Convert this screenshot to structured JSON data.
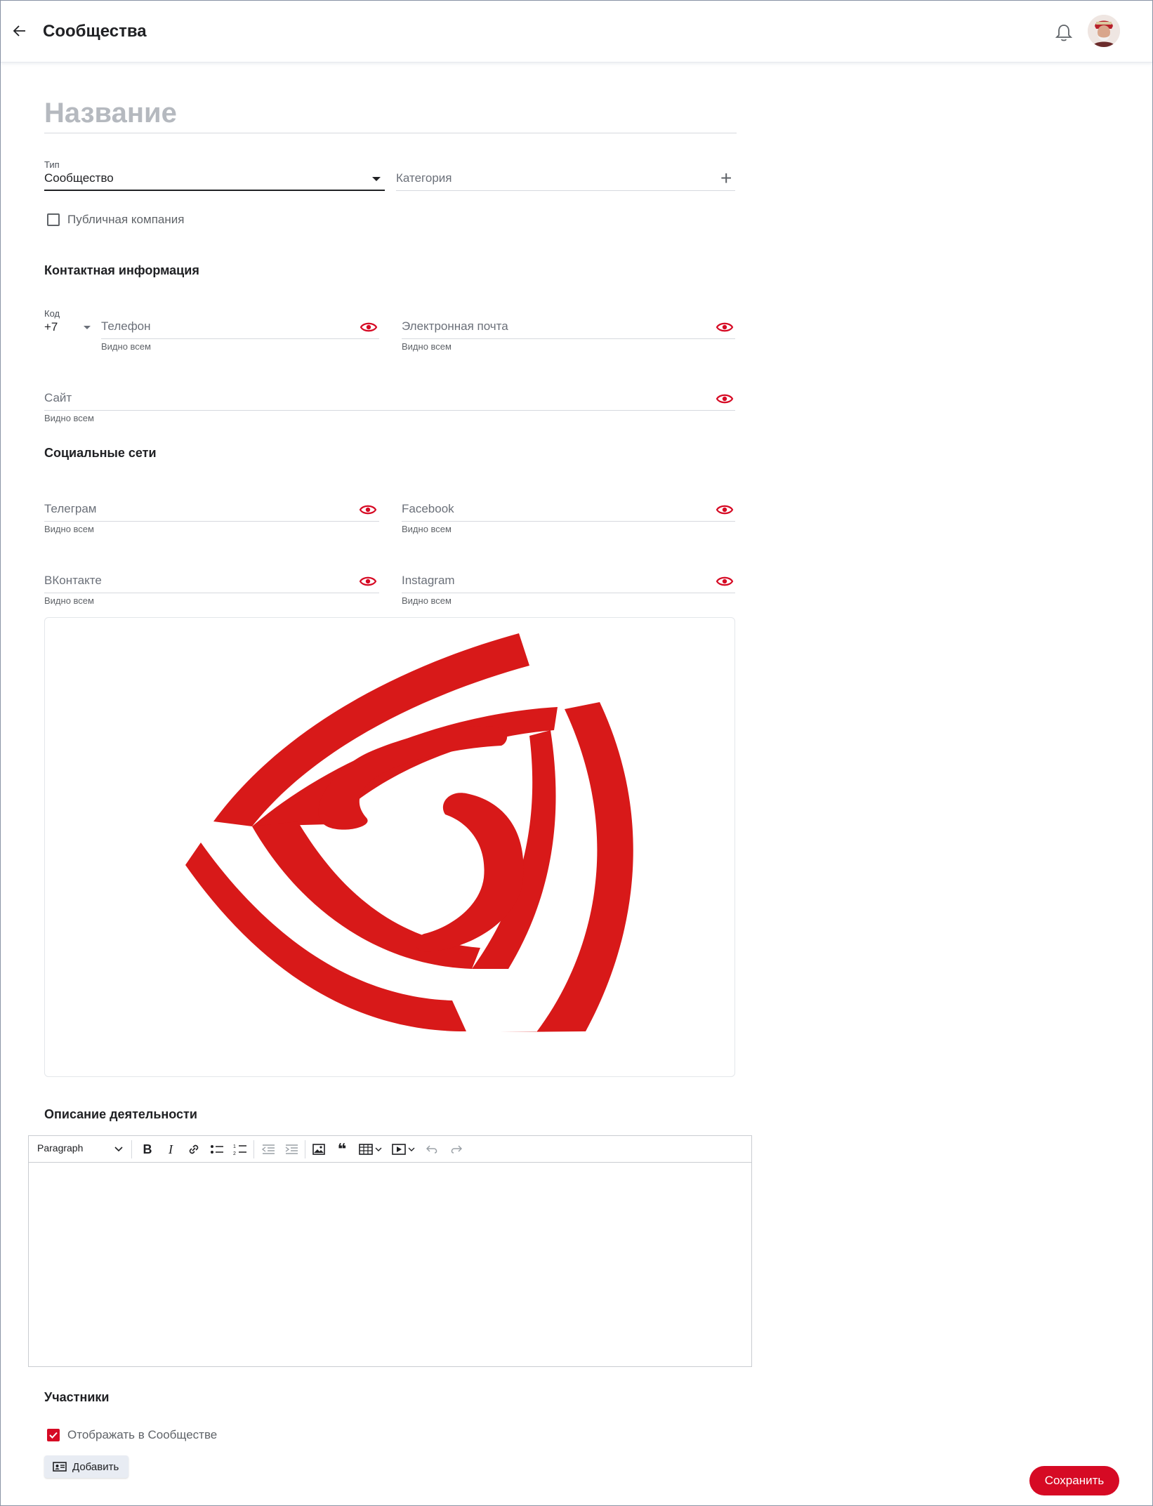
{
  "header": {
    "title": "Сообщества"
  },
  "form": {
    "name_placeholder": "Название",
    "type_label": "Тип",
    "type_value": "Сообщество",
    "category_placeholder": "Категория",
    "public_company_label": "Публичная компания",
    "public_company_checked": false
  },
  "contacts": {
    "title": "Контактная информация",
    "code_label": "Код",
    "code_value": "+7",
    "phone_placeholder": "Телефон",
    "phone_hint": "Видно всем",
    "email_placeholder": "Электронная почта",
    "email_hint": "Видно всем",
    "site_placeholder": "Сайт",
    "site_hint": "Видно всем"
  },
  "social": {
    "title": "Социальные сети",
    "telegram_placeholder": "Телеграм",
    "telegram_hint": "Видно всем",
    "facebook_placeholder": "Facebook",
    "facebook_hint": "Видно всем",
    "vk_placeholder": "ВКонтакте",
    "vk_hint": "Видно всем",
    "instagram_placeholder": "Instagram",
    "instagram_hint": "Видно всем"
  },
  "description": {
    "title": "Описание деятельности",
    "paragraph_label": "Paragraph"
  },
  "members": {
    "title": "Участники",
    "show_label": "Отображать в Сообществе",
    "show_checked": true,
    "add_label": "Добавить"
  },
  "actions": {
    "save_label": "Сохранить"
  },
  "colors": {
    "accent": "#d60a24",
    "logo_red": "#d81919"
  }
}
